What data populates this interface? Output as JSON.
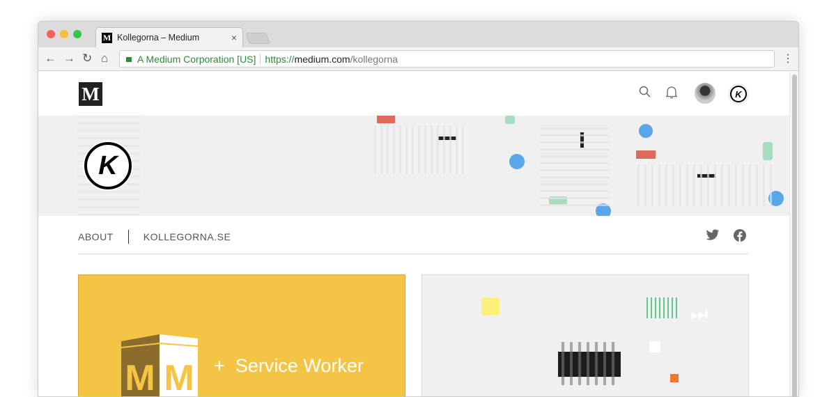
{
  "browser": {
    "tab_title": "Kollegorna – Medium",
    "tab_favicon": "M",
    "tab_close": "×",
    "security_label": "A Medium Corporation [US]",
    "url_scheme": "https://",
    "url_host": "medium.com",
    "url_path": "/kollegorna",
    "menu_icon": "⋮"
  },
  "header": {
    "logo": "M",
    "profile_badge": "K"
  },
  "publication": {
    "logo_letter": "K"
  },
  "nav": {
    "items": [
      "ABOUT",
      "KOLLEGORNA.SE"
    ]
  },
  "cards": [
    {
      "logo": "MM",
      "plus": "+",
      "title": "Service Worker",
      "bg": "#f5c445"
    }
  ]
}
